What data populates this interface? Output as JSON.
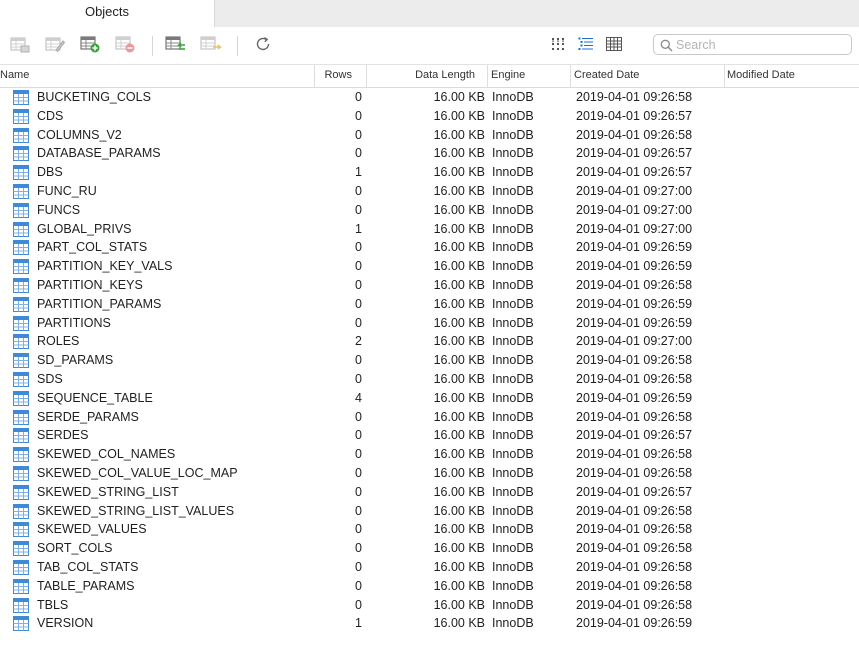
{
  "tabs": {
    "active": "Objects"
  },
  "toolbar": {
    "icons": [
      "open-table-icon",
      "design-table-icon",
      "new-table-icon",
      "delete-table-icon",
      "import-wizard-icon",
      "export-wizard-icon",
      "refresh-icon",
      "grid-view-icon",
      "list-view-icon",
      "detail-view-icon"
    ]
  },
  "search": {
    "placeholder": "Search",
    "value": ""
  },
  "columns": {
    "name": "Name",
    "rows": "Rows",
    "data_length": "Data Length",
    "engine": "Engine",
    "created": "Created Date",
    "modified": "Modified Date"
  },
  "colors": {
    "table_icon": "#3f8ad8",
    "add_green": "#3aa43a",
    "delete_red": "#e06060"
  },
  "tables": [
    {
      "name": "BUCKETING_COLS",
      "rows": "0",
      "size": "16.00 KB",
      "engine": "InnoDB",
      "created": "2019-04-01 09:26:58",
      "modified": ""
    },
    {
      "name": "CDS",
      "rows": "0",
      "size": "16.00 KB",
      "engine": "InnoDB",
      "created": "2019-04-01 09:26:57",
      "modified": ""
    },
    {
      "name": "COLUMNS_V2",
      "rows": "0",
      "size": "16.00 KB",
      "engine": "InnoDB",
      "created": "2019-04-01 09:26:58",
      "modified": ""
    },
    {
      "name": "DATABASE_PARAMS",
      "rows": "0",
      "size": "16.00 KB",
      "engine": "InnoDB",
      "created": "2019-04-01 09:26:57",
      "modified": ""
    },
    {
      "name": "DBS",
      "rows": "1",
      "size": "16.00 KB",
      "engine": "InnoDB",
      "created": "2019-04-01 09:26:57",
      "modified": ""
    },
    {
      "name": "FUNC_RU",
      "rows": "0",
      "size": "16.00 KB",
      "engine": "InnoDB",
      "created": "2019-04-01 09:27:00",
      "modified": ""
    },
    {
      "name": "FUNCS",
      "rows": "0",
      "size": "16.00 KB",
      "engine": "InnoDB",
      "created": "2019-04-01 09:27:00",
      "modified": ""
    },
    {
      "name": "GLOBAL_PRIVS",
      "rows": "1",
      "size": "16.00 KB",
      "engine": "InnoDB",
      "created": "2019-04-01 09:27:00",
      "modified": ""
    },
    {
      "name": "PART_COL_STATS",
      "rows": "0",
      "size": "16.00 KB",
      "engine": "InnoDB",
      "created": "2019-04-01 09:26:59",
      "modified": ""
    },
    {
      "name": "PARTITION_KEY_VALS",
      "rows": "0",
      "size": "16.00 KB",
      "engine": "InnoDB",
      "created": "2019-04-01 09:26:59",
      "modified": ""
    },
    {
      "name": "PARTITION_KEYS",
      "rows": "0",
      "size": "16.00 KB",
      "engine": "InnoDB",
      "created": "2019-04-01 09:26:58",
      "modified": ""
    },
    {
      "name": "PARTITION_PARAMS",
      "rows": "0",
      "size": "16.00 KB",
      "engine": "InnoDB",
      "created": "2019-04-01 09:26:59",
      "modified": ""
    },
    {
      "name": "PARTITIONS",
      "rows": "0",
      "size": "16.00 KB",
      "engine": "InnoDB",
      "created": "2019-04-01 09:26:59",
      "modified": ""
    },
    {
      "name": "ROLES",
      "rows": "2",
      "size": "16.00 KB",
      "engine": "InnoDB",
      "created": "2019-04-01 09:27:00",
      "modified": ""
    },
    {
      "name": "SD_PARAMS",
      "rows": "0",
      "size": "16.00 KB",
      "engine": "InnoDB",
      "created": "2019-04-01 09:26:58",
      "modified": ""
    },
    {
      "name": "SDS",
      "rows": "0",
      "size": "16.00 KB",
      "engine": "InnoDB",
      "created": "2019-04-01 09:26:58",
      "modified": ""
    },
    {
      "name": "SEQUENCE_TABLE",
      "rows": "4",
      "size": "16.00 KB",
      "engine": "InnoDB",
      "created": "2019-04-01 09:26:59",
      "modified": ""
    },
    {
      "name": "SERDE_PARAMS",
      "rows": "0",
      "size": "16.00 KB",
      "engine": "InnoDB",
      "created": "2019-04-01 09:26:58",
      "modified": ""
    },
    {
      "name": "SERDES",
      "rows": "0",
      "size": "16.00 KB",
      "engine": "InnoDB",
      "created": "2019-04-01 09:26:57",
      "modified": ""
    },
    {
      "name": "SKEWED_COL_NAMES",
      "rows": "0",
      "size": "16.00 KB",
      "engine": "InnoDB",
      "created": "2019-04-01 09:26:58",
      "modified": ""
    },
    {
      "name": "SKEWED_COL_VALUE_LOC_MAP",
      "rows": "0",
      "size": "16.00 KB",
      "engine": "InnoDB",
      "created": "2019-04-01 09:26:58",
      "modified": ""
    },
    {
      "name": "SKEWED_STRING_LIST",
      "rows": "0",
      "size": "16.00 KB",
      "engine": "InnoDB",
      "created": "2019-04-01 09:26:57",
      "modified": ""
    },
    {
      "name": "SKEWED_STRING_LIST_VALUES",
      "rows": "0",
      "size": "16.00 KB",
      "engine": "InnoDB",
      "created": "2019-04-01 09:26:58",
      "modified": ""
    },
    {
      "name": "SKEWED_VALUES",
      "rows": "0",
      "size": "16.00 KB",
      "engine": "InnoDB",
      "created": "2019-04-01 09:26:58",
      "modified": ""
    },
    {
      "name": "SORT_COLS",
      "rows": "0",
      "size": "16.00 KB",
      "engine": "InnoDB",
      "created": "2019-04-01 09:26:58",
      "modified": ""
    },
    {
      "name": "TAB_COL_STATS",
      "rows": "0",
      "size": "16.00 KB",
      "engine": "InnoDB",
      "created": "2019-04-01 09:26:58",
      "modified": ""
    },
    {
      "name": "TABLE_PARAMS",
      "rows": "0",
      "size": "16.00 KB",
      "engine": "InnoDB",
      "created": "2019-04-01 09:26:58",
      "modified": ""
    },
    {
      "name": "TBLS",
      "rows": "0",
      "size": "16.00 KB",
      "engine": "InnoDB",
      "created": "2019-04-01 09:26:58",
      "modified": ""
    },
    {
      "name": "VERSION",
      "rows": "1",
      "size": "16.00 KB",
      "engine": "InnoDB",
      "created": "2019-04-01 09:26:59",
      "modified": ""
    }
  ]
}
